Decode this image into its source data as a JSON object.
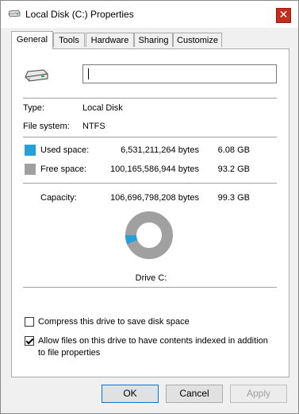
{
  "window": {
    "title": "Local Disk (C:) Properties",
    "close_glyph": "✕"
  },
  "tabs": [
    {
      "label": "General",
      "active": true
    },
    {
      "label": "Tools",
      "active": false
    },
    {
      "label": "Hardware",
      "active": false
    },
    {
      "label": "Sharing",
      "active": false
    },
    {
      "label": "Customize",
      "active": false
    }
  ],
  "general": {
    "drive_name_value": "",
    "type_label": "Type:",
    "type_value": "Local Disk",
    "fs_label": "File system:",
    "fs_value": "NTFS",
    "used": {
      "label": "Used space:",
      "bytes": "6,531,211,264 bytes",
      "size": "6.08 GB",
      "color": "#26a0da"
    },
    "free": {
      "label": "Free space:",
      "bytes": "100,165,586,944 bytes",
      "size": "93.2 GB",
      "color": "#a0a0a0"
    },
    "capacity": {
      "label": "Capacity:",
      "bytes": "106,696,798,208 bytes",
      "size": "99.3 GB"
    },
    "drive_caption": "Drive C:",
    "used_fraction": 0.0612,
    "compress_label": "Compress this drive to save disk space",
    "compress_checked": false,
    "index_label_1": "Allow files on this drive to have contents indexed in addition",
    "index_label_2": "to file properties",
    "index_checked": true
  },
  "buttons": {
    "ok": "OK",
    "cancel": "Cancel",
    "apply": "Apply"
  }
}
